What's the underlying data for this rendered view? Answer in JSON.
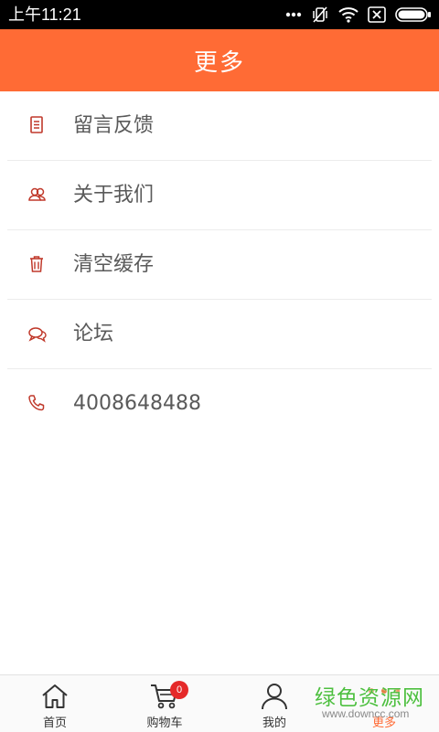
{
  "status_bar": {
    "time": "上午11:21"
  },
  "header": {
    "title": "更多"
  },
  "menu": {
    "items": [
      {
        "label": "留言反馈",
        "icon": "document-icon"
      },
      {
        "label": "关于我们",
        "icon": "users-icon"
      },
      {
        "label": "清空缓存",
        "icon": "trash-icon"
      },
      {
        "label": "论坛",
        "icon": "chat-bubbles-icon"
      },
      {
        "label": "4008648488",
        "icon": "phone-icon"
      }
    ]
  },
  "tab_bar": {
    "tabs": [
      {
        "label": "首页",
        "icon": "home-icon"
      },
      {
        "label": "购物车",
        "icon": "cart-icon",
        "badge": "0"
      },
      {
        "label": "我的",
        "icon": "person-icon"
      },
      {
        "label": "更多",
        "icon": "more-dots-icon",
        "active": true
      }
    ]
  },
  "watermark": {
    "title": "绿色资源网",
    "url": "www.downcc.com"
  },
  "colors": {
    "accent": "#ff6b35",
    "icon_red": "#c0392b",
    "badge_red": "#e52929",
    "watermark_green": "#4dbf3f"
  }
}
